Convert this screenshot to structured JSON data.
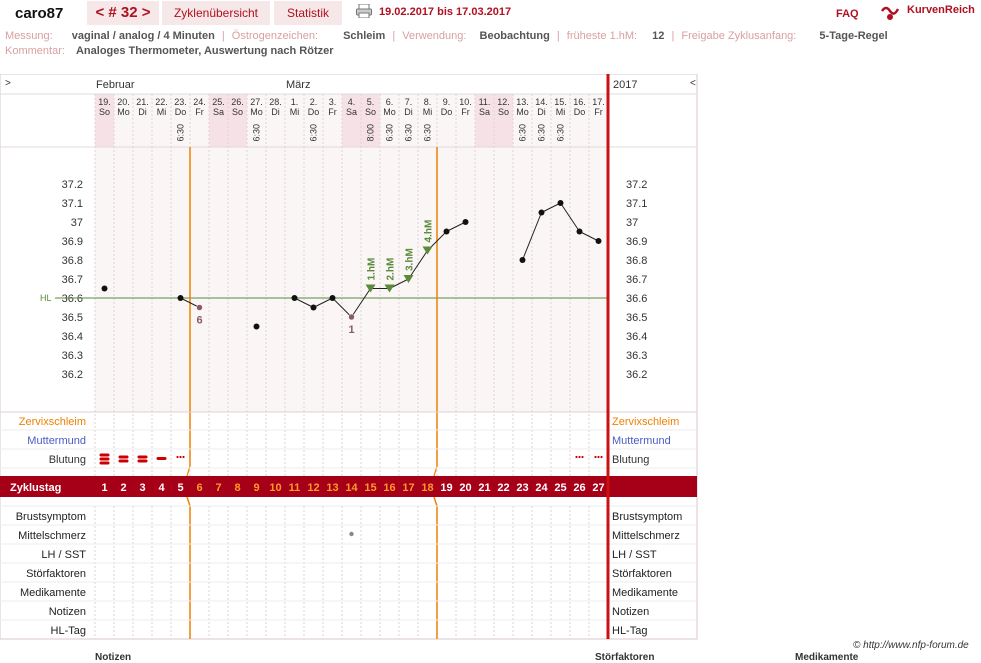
{
  "header": {
    "username": "caro87",
    "cycle_nav": "< # 32 >",
    "tab_overview": "Zyklenübersicht",
    "tab_stats": "Statistik",
    "date_range": "19.02.2017 bis 17.03.2017",
    "faq": "FAQ",
    "logo": "KurvenReich",
    "icons": [
      "print-icon",
      "kurvenreich-logo-icon"
    ]
  },
  "meta": {
    "messung_label": "Messung:",
    "messung": "vaginal / analog / 4 Minuten",
    "oestrogen_label": "Östrogenzeichen:",
    "oestrogen": "Schleim",
    "verwendung_label": "Verwendung:",
    "verwendung": "Beobachtung",
    "frueheste_label": "früheste 1.hM:",
    "frueheste": "12",
    "freigabe_label": "Freigabe Zyklusanfang:",
    "freigabe": "5-Tage-Regel",
    "kommentar_label": "Kommentar:",
    "kommentar": "Analoges Thermometer, Auswertung nach Rötzer"
  },
  "footer": {
    "copyright": "© http://www.nfp-forum.de",
    "left_heading": "Notizen",
    "mid_heading": "Störfaktoren",
    "right_heading": "Medikamente"
  },
  "colors": {
    "brand": "#b01020",
    "cycle_bar": "#a50018",
    "orange": "#f08000",
    "green": "#5a8a3a",
    "weekend": "#f6e2e6",
    "grid_bg": "#fbf6f6"
  },
  "chart_data": {
    "type": "line",
    "nav_left": ">",
    "nav_right": "<",
    "months": [
      {
        "label": "Februar",
        "day_index": 0
      },
      {
        "label": "März",
        "day_index": 10
      }
    ],
    "year_label": "2017",
    "days": [
      {
        "date": "19.",
        "wd": "So",
        "time": "",
        "weekend": true
      },
      {
        "date": "20.",
        "wd": "Mo",
        "time": "",
        "weekend": false
      },
      {
        "date": "21.",
        "wd": "Di",
        "time": "",
        "weekend": false
      },
      {
        "date": "22.",
        "wd": "Mi",
        "time": "",
        "weekend": false
      },
      {
        "date": "23.",
        "wd": "Do",
        "time": "6:30",
        "weekend": false
      },
      {
        "date": "24.",
        "wd": "Fr",
        "time": "",
        "weekend": false
      },
      {
        "date": "25.",
        "wd": "Sa",
        "time": "",
        "weekend": true
      },
      {
        "date": "26.",
        "wd": "So",
        "time": "",
        "weekend": true
      },
      {
        "date": "27.",
        "wd": "Mo",
        "time": "6:30",
        "weekend": false
      },
      {
        "date": "28.",
        "wd": "Di",
        "time": "",
        "weekend": false
      },
      {
        "date": "1.",
        "wd": "Mi",
        "time": "",
        "weekend": false
      },
      {
        "date": "2.",
        "wd": "Do",
        "time": "6:30",
        "weekend": false
      },
      {
        "date": "3.",
        "wd": "Fr",
        "time": "",
        "weekend": false
      },
      {
        "date": "4.",
        "wd": "Sa",
        "time": "",
        "weekend": true
      },
      {
        "date": "5.",
        "wd": "So",
        "time": "8:00",
        "weekend": true
      },
      {
        "date": "6.",
        "wd": "Mo",
        "time": "6:30",
        "weekend": false
      },
      {
        "date": "7.",
        "wd": "Di",
        "time": "6:30",
        "weekend": false
      },
      {
        "date": "8.",
        "wd": "Mi",
        "time": "6:30",
        "weekend": false
      },
      {
        "date": "9.",
        "wd": "Do",
        "time": "",
        "weekend": false
      },
      {
        "date": "10.",
        "wd": "Fr",
        "time": "",
        "weekend": false
      },
      {
        "date": "11.",
        "wd": "Sa",
        "time": "",
        "weekend": true
      },
      {
        "date": "12.",
        "wd": "So",
        "time": "",
        "weekend": true
      },
      {
        "date": "13.",
        "wd": "Mo",
        "time": "6:30",
        "weekend": false
      },
      {
        "date": "14.",
        "wd": "Di",
        "time": "6:30",
        "weekend": false
      },
      {
        "date": "15.",
        "wd": "Mi",
        "time": "6:30",
        "weekend": false
      },
      {
        "date": "16.",
        "wd": "Do",
        "time": "",
        "weekend": false
      },
      {
        "date": "17.",
        "wd": "Fr",
        "time": "",
        "weekend": false
      }
    ],
    "y_ticks": [
      "37.2",
      "37.1",
      "37",
      "36.9",
      "36.8",
      "36.7",
      "36.6",
      "36.5",
      "36.4",
      "36.3",
      "36.2"
    ],
    "ylim": [
      36.1,
      37.3
    ],
    "cover_line": {
      "value": 36.6,
      "label": "HL"
    },
    "temperatures": [
      36.65,
      null,
      null,
      null,
      36.6,
      36.55,
      null,
      null,
      36.45,
      null,
      36.6,
      36.55,
      36.6,
      36.5,
      36.65,
      36.65,
      36.7,
      36.85,
      36.95,
      37.0,
      null,
      null,
      36.8,
      37.05,
      37.1,
      36.95,
      36.9
    ],
    "excluded_days": [
      5,
      13
    ],
    "excluded_notes": [
      {
        "day": 5,
        "label": "6"
      },
      {
        "day": 13,
        "label": "1"
      }
    ],
    "higher_measurements": [
      {
        "day": 14,
        "label": "1.hM"
      },
      {
        "day": 15,
        "label": "2.hM"
      },
      {
        "day": 16,
        "label": "3.hM"
      },
      {
        "day": 17,
        "label": "4.hM"
      }
    ],
    "vertical_markers": [
      5,
      18
    ],
    "upper_rows": [
      {
        "label": "Zervixschleim",
        "color": "#f08000"
      },
      {
        "label": "Muttermund",
        "color": "#4a5cc0"
      },
      {
        "label": "Blutung",
        "color": "#333333"
      }
    ],
    "bleeding": [
      "heavy",
      "medium",
      "medium",
      "light",
      "spot",
      null,
      null,
      null,
      null,
      null,
      null,
      null,
      null,
      null,
      null,
      null,
      null,
      null,
      null,
      null,
      null,
      null,
      null,
      null,
      null,
      "spot",
      "spot"
    ],
    "cycle_label": "Zyklustag",
    "cycle_days": [
      "1",
      "2",
      "3",
      "4",
      "5",
      "6",
      "7",
      "8",
      "9",
      "10",
      "11",
      "12",
      "13",
      "14",
      "15",
      "16",
      "17",
      "18",
      "19",
      "20",
      "21",
      "22",
      "23",
      "24",
      "25",
      "26",
      "27"
    ],
    "fertile_cycle_days": [
      6,
      7,
      8,
      9,
      10,
      11,
      12,
      13,
      14,
      15,
      16,
      17,
      18
    ],
    "lower_rows": [
      "Brustsymptom",
      "Mittelschmerz",
      "LH / SST",
      "Störfaktoren",
      "Medikamente",
      "Notizen",
      "HL-Tag"
    ],
    "mittelschmerz_days": [
      13
    ]
  }
}
